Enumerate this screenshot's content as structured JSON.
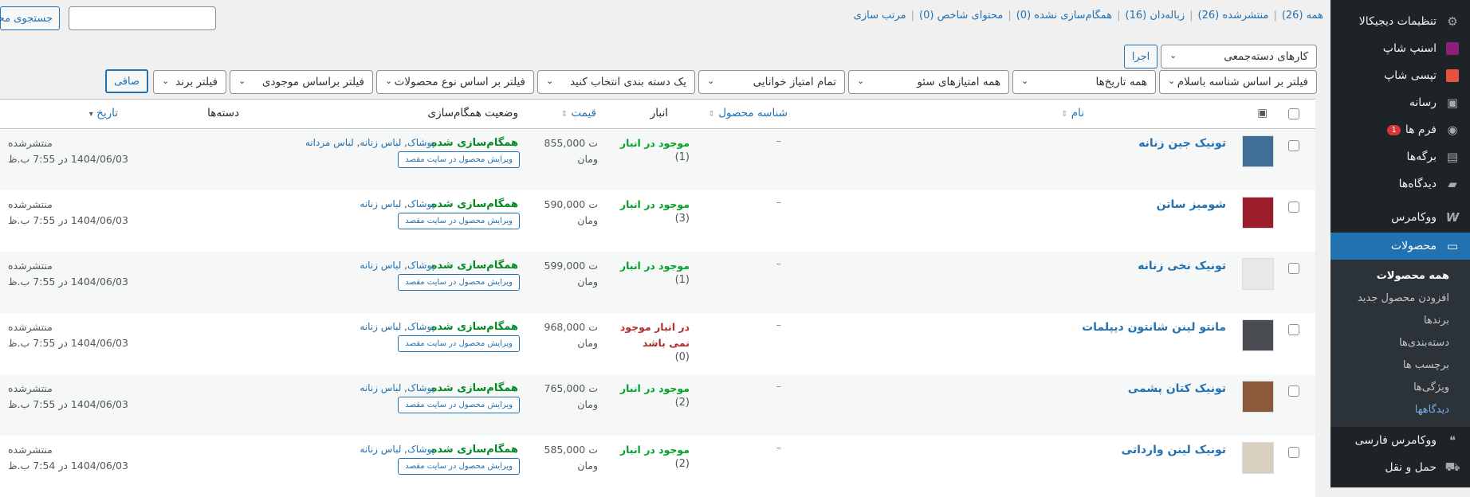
{
  "sidebar": {
    "items": [
      {
        "label": "تنظیمات دیجیکالا",
        "icon": "digikala-settings-icon"
      },
      {
        "label": "اسنپ شاپ",
        "icon": "snappshop-icon"
      },
      {
        "label": "تپسی شاپ",
        "icon": "tapsishop-icon"
      },
      {
        "label": "رسانه",
        "icon": "media-icon"
      },
      {
        "label": "فرم ها",
        "icon": "forms-icon",
        "badge": "1"
      },
      {
        "label": "برگه‌ها",
        "icon": "pages-icon"
      },
      {
        "label": "دیدگاه‌ها",
        "icon": "comments-icon"
      },
      {
        "label": "ووکامرس",
        "icon": "woocommerce-icon"
      },
      {
        "label": "محصولات",
        "icon": "products-icon"
      }
    ],
    "submenu": [
      {
        "label": "همه محصولات"
      },
      {
        "label": "افزودن محصول جدید"
      },
      {
        "label": "برندها"
      },
      {
        "label": "دسته‌بندی‌ها"
      },
      {
        "label": "برچسب ها"
      },
      {
        "label": "ویژگی‌ها"
      },
      {
        "label": "دیدگاهها"
      }
    ],
    "after": [
      {
        "label": "ووکامرس فارسی",
        "icon": "woocommerce-farsi-icon"
      },
      {
        "label": "حمل و نقل",
        "icon": "shipping-icon"
      }
    ]
  },
  "views": {
    "all": "همه (26)",
    "published": "منتشرشده (26)",
    "trash": "زباله‌دان (16)",
    "not_synced": "همگام‌سازی نشده (0)",
    "featured": "محتوای شاخص (0)",
    "sort": "مرتب سازی"
  },
  "search": {
    "button": "جستجوی محصولات",
    "value": ""
  },
  "bulk": {
    "select": "کارهای دسته‌جمعی",
    "apply": "اجرا"
  },
  "filters": {
    "basalam": "فیلتر بر اساس شناسه باسلام",
    "dates": "همه تاریخ‌ها",
    "seo": "همه امتیازهای سئو",
    "readability": "تمام امتیاز خوانایی",
    "category": "یک دسته بندی انتخاب کنید",
    "type": "فیلتر بر اساس نوع محصولات",
    "stock": "فیلتر براساس موجودی",
    "brand": "فیلتر برند",
    "filter_button": "صافی"
  },
  "columns": {
    "name": "نام",
    "sku": "شناسه محصول",
    "stock": "انبار",
    "price": "قیمت",
    "sync": "وضعیت همگام‌سازی",
    "categories": "دسته‌ها",
    "date": "تاریخ"
  },
  "products": [
    {
      "name": "تونیک جین زنانه",
      "sku": "–",
      "stock": "موجود در انبار",
      "qty": "(1)",
      "in_stock": true,
      "price": "855,000",
      "currency": "تومان",
      "sync": "همگام‌سازی شده",
      "edit": "ویرایش محصول در سایت مقصد",
      "categories": "پوشاک, لباس زنانه, لباس مردانه",
      "status": "منتشرشده",
      "date": "1404/06/03 در 7:55 ب.ظ",
      "thumb": "#3f6f96"
    },
    {
      "name": "شومیز ساتن",
      "sku": "–",
      "stock": "موجود در انبار",
      "qty": "(3)",
      "in_stock": true,
      "price": "590,000",
      "currency": "تومان",
      "sync": "همگام‌سازی شده",
      "edit": "ویرایش محصول در سایت مقصد",
      "categories": "پوشاک, لباس زنانه",
      "status": "منتشرشده",
      "date": "1404/06/03 در 7:55 ب.ظ",
      "thumb": "#9b1c2a"
    },
    {
      "name": "تونیک نخی زنانه",
      "sku": "–",
      "stock": "موجود در انبار",
      "qty": "(1)",
      "in_stock": true,
      "price": "599,000",
      "currency": "تومان",
      "sync": "همگام‌سازی شده",
      "edit": "ویرایش محصول در سایت مقصد",
      "categories": "پوشاک, لباس زنانه",
      "status": "منتشرشده",
      "date": "1404/06/03 در 7:55 ب.ظ",
      "thumb": "#e8e8ea"
    },
    {
      "name": "مانتو لینن شانتون دیپلمات",
      "sku": "–",
      "stock": "در انبار موجود",
      "stock2": "نمی باشد",
      "qty": "(0)",
      "in_stock": false,
      "price": "968,000",
      "currency": "تومان",
      "sync": "همگام‌سازی شده",
      "edit": "ویرایش محصول در سایت مقصد",
      "categories": "پوشاک, لباس زنانه",
      "status": "منتشرشده",
      "date": "1404/06/03 در 7:55 ب.ظ",
      "thumb": "#4a4d52"
    },
    {
      "name": "تونیک کتان پشمی",
      "sku": "–",
      "stock": "موجود در انبار",
      "qty": "(2)",
      "in_stock": true,
      "price": "765,000",
      "currency": "تومان",
      "sync": "همگام‌سازی شده",
      "edit": "ویرایش محصول در سایت مقصد",
      "categories": "پوشاک, لباس زنانه",
      "status": "منتشرشده",
      "date": "1404/06/03 در 7:55 ب.ظ",
      "thumb": "#8a5a3a"
    },
    {
      "name": "تونیک لینن وارداتی",
      "sku": "–",
      "stock": "موجود در انبار",
      "qty": "(2)",
      "in_stock": true,
      "price": "585,000",
      "currency": "تومان",
      "sync": "همگام‌سازی شده",
      "edit": "ویرایش محصول در سایت مقصد",
      "categories": "پوشاک, لباس زنانه",
      "status": "منتشرشده",
      "date": "1404/06/03 در 7:54 ب.ظ",
      "thumb": "#d8cfc0"
    }
  ]
}
